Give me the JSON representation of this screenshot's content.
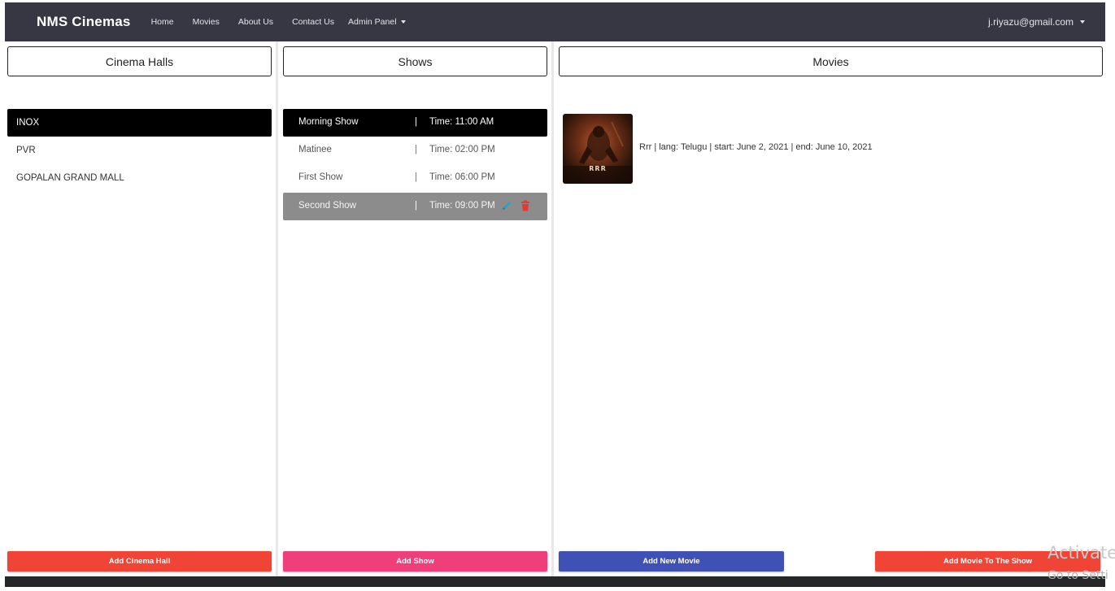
{
  "navbar": {
    "brand": "NMS Cinemas",
    "links": [
      "Home",
      "Movies",
      "About Us",
      "Contact Us"
    ],
    "admin_panel": "Admin Panel",
    "user_email": "j.riyazu@gmail.com"
  },
  "halls": {
    "title": "Cinema Halls",
    "items": [
      "INOX",
      "PVR",
      "GOPALAN GRAND MALL"
    ],
    "selected": "INOX",
    "add_button": "Add Cinema Hall"
  },
  "shows": {
    "title": "Shows",
    "separator": "|",
    "items": [
      {
        "name": "Morning Show",
        "time": "Time: 11:00 AM"
      },
      {
        "name": "Matinee",
        "time": "Time: 02:00 PM"
      },
      {
        "name": "First Show",
        "time": "Time: 06:00 PM"
      },
      {
        "name": "Second Show",
        "time": "Time: 09:00 PM"
      }
    ],
    "selected": "Morning Show",
    "hovered": "Second Show",
    "add_button": "Add Show"
  },
  "movies": {
    "title": "Movies",
    "items": [
      {
        "info": "Rrr | lang: Telugu | start: June 2, 2021 | end: June 10, 2021",
        "poster_text": "RRR"
      }
    ],
    "add_new_button": "Add New Movie",
    "add_to_show_button": "Add Movie To The Show"
  },
  "watermark": {
    "line1": "Activate",
    "line2": "Go to Setti"
  },
  "colors": {
    "navbar_bg": "#363742",
    "add_hall": "#f04437",
    "add_show": "#f03e7a",
    "add_new_movie": "#3f51b5",
    "add_movie_to_show": "#f04437",
    "edit_icon": "#2aa1c8",
    "delete_icon": "#e53935"
  }
}
